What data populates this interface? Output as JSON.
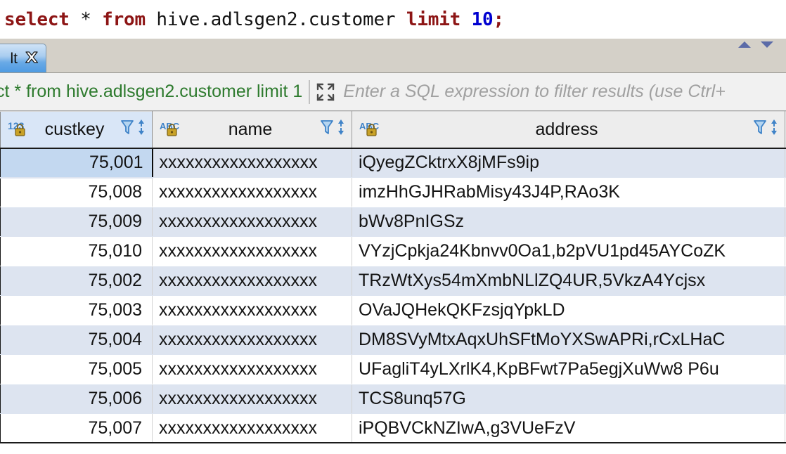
{
  "editor": {
    "sql_tokens": [
      {
        "text": "select",
        "kind": "keyword"
      },
      {
        "text": " * ",
        "kind": "operator"
      },
      {
        "text": "from",
        "kind": "keyword"
      },
      {
        "text": " hive.adlsgen2.customer ",
        "kind": "plain"
      },
      {
        "text": "limit",
        "kind": "keyword"
      },
      {
        "text": " ",
        "kind": "plain"
      },
      {
        "text": "10",
        "kind": "number"
      },
      {
        "text": ";",
        "kind": "semicolon"
      }
    ],
    "sql_full_text": "select * from hive.adlsgen2.customer limit 10;"
  },
  "tabbar": {
    "tab_label": "lt",
    "close_icon": "close-x-icon",
    "scroll_up_icon": "triangle-up-icon",
    "scroll_down_icon": "triangle-down-icon"
  },
  "filterbar": {
    "query_text": "ct * from hive.adlsgen2.customer limit 1",
    "expand_icon": "expand-maximize-icon",
    "placeholder": "Enter a SQL expression to filter results (use Ctrl+"
  },
  "grid": {
    "columns": [
      {
        "name": "custkey",
        "type_icon": "number-123-locked-icon",
        "type": "123",
        "locked": true,
        "align": "right",
        "selected": true
      },
      {
        "name": "name",
        "type_icon": "text-abc-locked-icon",
        "type": "ABC",
        "locked": true,
        "align": "left",
        "selected": false
      },
      {
        "name": "address",
        "type_icon": "text-abc-locked-icon",
        "type": "ABC",
        "locked": true,
        "align": "left",
        "selected": false
      },
      {
        "name": "",
        "type_icon": "number-123-locked-icon",
        "type": "123",
        "locked": true,
        "align": "left",
        "selected": false
      }
    ],
    "header_filter_icon": "filter-funnel-icon",
    "header_sort_icon": "sort-up-down-icon",
    "selected_cell": {
      "row": 0,
      "column": 0
    },
    "rows": [
      {
        "custkey": "75,001",
        "name": "xxxxxxxxxxxxxxxxxx",
        "address": "iQyegZCktrxX8jMFs9ip"
      },
      {
        "custkey": "75,008",
        "name": "xxxxxxxxxxxxxxxxxx",
        "address": "imzHhGJHRabMisy43J4P,RAo3K"
      },
      {
        "custkey": "75,009",
        "name": "xxxxxxxxxxxxxxxxxx",
        "address": "bWv8PnIGSz"
      },
      {
        "custkey": "75,010",
        "name": "xxxxxxxxxxxxxxxxxx",
        "address": "VYzjCpkja24Kbnvv0Oa1,b2pVU1pd45AYCoZK"
      },
      {
        "custkey": "75,002",
        "name": "xxxxxxxxxxxxxxxxxx",
        "address": "TRzWtXys54mXmbNLlZQ4UR,5VkzA4Ycjsx"
      },
      {
        "custkey": "75,003",
        "name": "xxxxxxxxxxxxxxxxxx",
        "address": "OVaJQHekQKFzsjqYpkLD"
      },
      {
        "custkey": "75,004",
        "name": "xxxxxxxxxxxxxxxxxx",
        "address": "DM8SVyMtxAqxUhSFtMoYXSwAPRi,rCxLHaC"
      },
      {
        "custkey": "75,005",
        "name": "xxxxxxxxxxxxxxxxxx",
        "address": "UFagliT4yLXrlK4,KpBFwt7Pa5egjXuWw8 P6u"
      },
      {
        "custkey": "75,006",
        "name": "xxxxxxxxxxxxxxxxxx",
        "address": "TCS8unq57G"
      },
      {
        "custkey": "75,007",
        "name": "xxxxxxxxxxxxxxxxxx",
        "address": "iPQBVCkNZIwA,g3VUeFzV"
      }
    ]
  },
  "colors": {
    "keyword": "#8d1515",
    "number": "#0000d0",
    "filter_query": "#2d7a2d",
    "placeholder": "#a0a0a0",
    "row_odd": "#dde4f0",
    "row_even": "#ffffff",
    "selection": "#c3d8f0",
    "header_selected": "#d9e6f7",
    "tab_accent": "#4e9ae2",
    "icon_blue": "#4a90d9",
    "lock_gold": "#b8860b"
  }
}
